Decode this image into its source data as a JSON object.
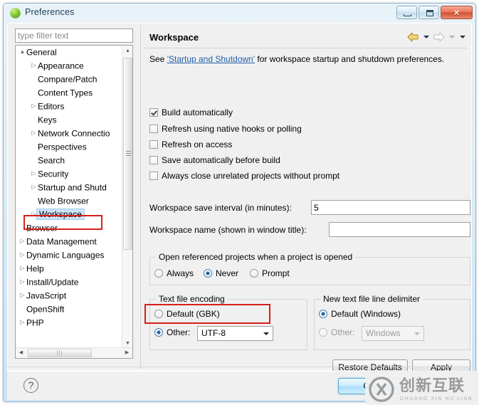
{
  "window": {
    "title": "Preferences",
    "icon": "eclipse-green-sphere-icon",
    "buttons": {
      "minimize": "minimize-icon",
      "maximize": "maximize-icon",
      "close": "×"
    }
  },
  "sidebar": {
    "filter": {
      "placeholder": "type filter text",
      "value": ""
    },
    "items": [
      {
        "label": "General",
        "level": 1,
        "arrow": "▲",
        "expanded": true,
        "selected": false
      },
      {
        "label": "Appearance",
        "level": 2,
        "arrow": "▷",
        "expanded": false,
        "selected": false
      },
      {
        "label": "Compare/Patch",
        "level": 2,
        "arrow": "",
        "expanded": false,
        "selected": false
      },
      {
        "label": "Content Types",
        "level": 2,
        "arrow": "",
        "expanded": false,
        "selected": false
      },
      {
        "label": "Editors",
        "level": 2,
        "arrow": "▷",
        "expanded": false,
        "selected": false
      },
      {
        "label": "Keys",
        "level": 2,
        "arrow": "",
        "expanded": false,
        "selected": false
      },
      {
        "label": "Network Connectio",
        "level": 2,
        "arrow": "▷",
        "expanded": false,
        "selected": false
      },
      {
        "label": "Perspectives",
        "level": 2,
        "arrow": "",
        "expanded": false,
        "selected": false
      },
      {
        "label": "Search",
        "level": 2,
        "arrow": "",
        "expanded": false,
        "selected": false
      },
      {
        "label": "Security",
        "level": 2,
        "arrow": "▷",
        "expanded": false,
        "selected": false
      },
      {
        "label": "Startup and Shutd",
        "level": 2,
        "arrow": "▷",
        "expanded": false,
        "selected": false
      },
      {
        "label": "Web Browser",
        "level": 2,
        "arrow": "",
        "expanded": false,
        "selected": false
      },
      {
        "label": "Workspace",
        "level": 2,
        "arrow": "▷",
        "expanded": false,
        "selected": true
      },
      {
        "label": "Browser",
        "level": 1,
        "arrow": "",
        "expanded": false,
        "selected": false
      },
      {
        "label": "Data Management",
        "level": 1,
        "arrow": "▷",
        "expanded": false,
        "selected": false
      },
      {
        "label": "Dynamic Languages",
        "level": 1,
        "arrow": "▷",
        "expanded": false,
        "selected": false
      },
      {
        "label": "Help",
        "level": 1,
        "arrow": "▷",
        "expanded": false,
        "selected": false
      },
      {
        "label": "Install/Update",
        "level": 1,
        "arrow": "▷",
        "expanded": false,
        "selected": false
      },
      {
        "label": "JavaScript",
        "level": 1,
        "arrow": "▷",
        "expanded": false,
        "selected": false
      },
      {
        "label": "OpenShift",
        "level": 1,
        "arrow": "",
        "expanded": false,
        "selected": false
      },
      {
        "label": "PHP",
        "level": 1,
        "arrow": "▷",
        "expanded": false,
        "selected": false
      }
    ],
    "scroll": {
      "up_arrow": "▲",
      "down_arrow": "▼",
      "left_arrow": "◀",
      "right_arrow": "▶",
      "h_grip": "|||"
    }
  },
  "page": {
    "title": "Workspace",
    "nav": {
      "back_icon": "back-arrow-icon",
      "back_menu_icon": "chevron-down-icon",
      "forward_icon": "forward-arrow-icon",
      "forward_menu_icon": "chevron-down-icon",
      "view_menu_icon": "chevron-down-icon"
    },
    "description": {
      "prefix": "See ",
      "link": "'Startup and Shutdown'",
      "suffix": " for workspace startup and shutdown preferences."
    },
    "checkboxes": [
      {
        "label": "Build automatically",
        "checked": true
      },
      {
        "label": "Refresh using native hooks or polling",
        "checked": false
      },
      {
        "label": "Refresh on access",
        "checked": false
      },
      {
        "label": "Save automatically before build",
        "checked": false
      },
      {
        "label": "Always close unrelated projects without prompt",
        "checked": false
      }
    ],
    "fields": [
      {
        "label": "Workspace save interval (in minutes):",
        "value": "5",
        "placeholder": ""
      },
      {
        "label": "Workspace name (shown in window title):",
        "value": "",
        "placeholder": ""
      }
    ],
    "open_referenced": {
      "title": "Open referenced projects when a project is opened",
      "options": [
        {
          "label": "Always",
          "selected": false
        },
        {
          "label": "Never",
          "selected": true
        },
        {
          "label": "Prompt",
          "selected": false
        }
      ]
    },
    "text_file_encoding": {
      "title": "Text file encoding",
      "default_label": "Default (GBK)",
      "default_selected": false,
      "other_label": "Other:",
      "other_selected": true,
      "other_value": "UTF-8"
    },
    "line_delimiter": {
      "title": "New text file line delimiter",
      "default_label": "Default (Windows)",
      "default_selected": true,
      "other_label": "Other:",
      "other_selected": false,
      "other_value": "Windows",
      "other_disabled": true
    },
    "buttons": {
      "restore_defaults": "Restore Defaults",
      "apply": "Apply"
    }
  },
  "footer": {
    "help_icon": "?",
    "ok_button": "OK"
  },
  "watermark": {
    "chinese": "创新互联",
    "english": "CHUANG XIN HU LIAN",
    "mark": "cx-logo-icon"
  },
  "colors": {
    "annotation": "#d91f17",
    "selection": "#cde4f7",
    "link": "#1f5fa8",
    "radio_accent": "#1f6aa8",
    "title_icon": "#6cbf2e"
  }
}
